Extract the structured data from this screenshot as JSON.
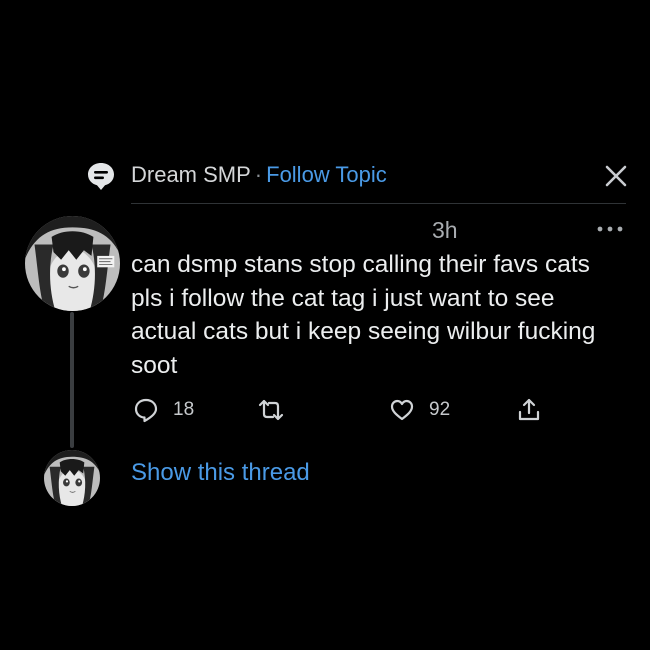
{
  "topic": {
    "name": "Dream SMP",
    "separator": "·",
    "follow_label": "Follow Topic",
    "icon": "topic-speech-bubble-icon",
    "close_icon": "close-icon"
  },
  "tweet": {
    "timestamp": "3h",
    "more_icon": "more-options-icon",
    "text": "can dsmp stans stop calling their favs cats pls i follow the cat tag i just want to see actual cats but i keep seeing wilbur fucking soot",
    "avatar": "anime-girl-avatar",
    "actions": {
      "reply_count": "18",
      "retweet_count": "",
      "like_count": "92",
      "reply_icon": "reply-icon",
      "retweet_icon": "retweet-icon",
      "like_icon": "heart-icon",
      "share_icon": "share-icon"
    }
  },
  "thread": {
    "show_label": "Show this thread"
  },
  "colors": {
    "background": "#000000",
    "link": "#4a9ae6",
    "text": "#eceeef",
    "muted": "#a8acb0"
  }
}
